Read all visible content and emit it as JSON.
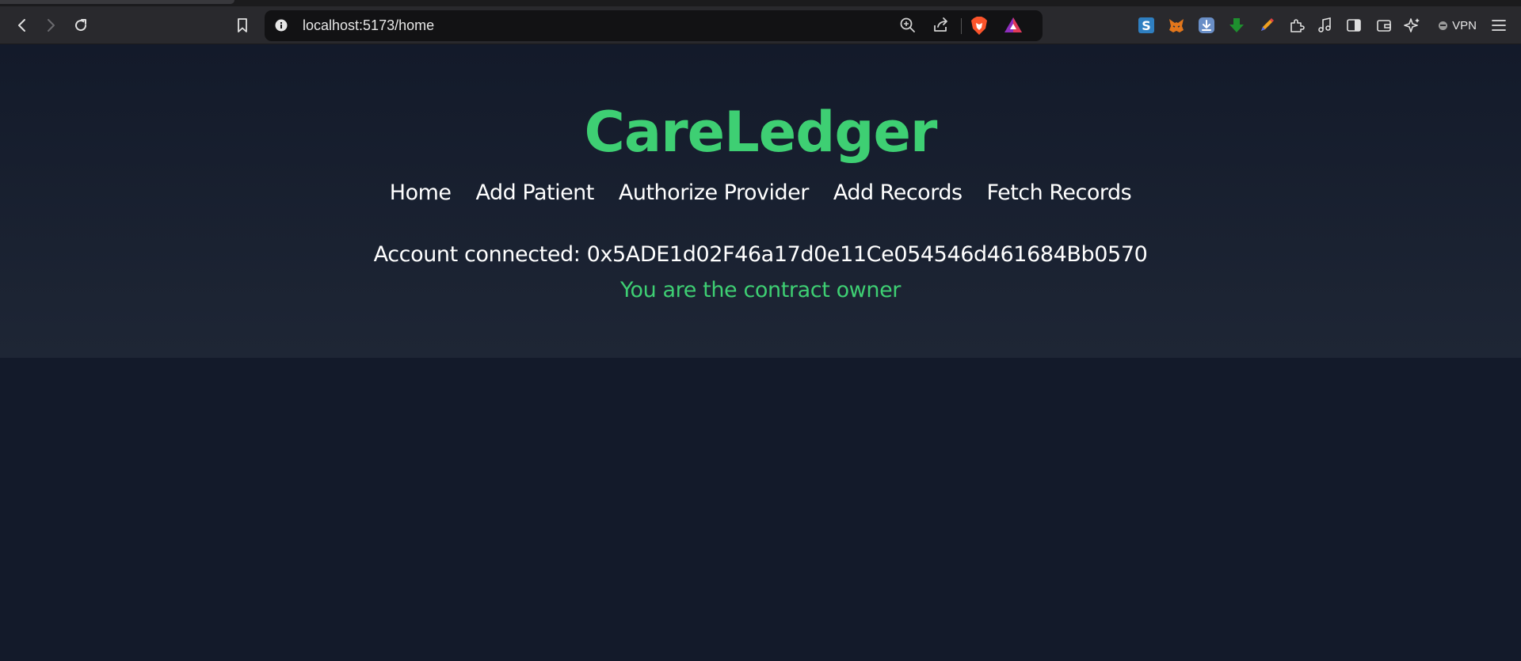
{
  "browser": {
    "url": "localhost:5173/home",
    "vpn_label": "VPN",
    "icons": [
      "back-icon",
      "forward-icon",
      "reload-icon",
      "bookmark-icon",
      "site-info-icon",
      "zoom-icon",
      "share-icon",
      "brave-shields-icon",
      "brave-rewards-icon",
      "extension-s-icon",
      "metamask-icon",
      "download-ext-icon",
      "green-arrow-ext-icon",
      "pencil-ext-icon",
      "extensions-icon",
      "media-icon",
      "sidebar-icon",
      "wallet-icon",
      "leo-ai-icon",
      "menu-icon"
    ]
  },
  "app": {
    "title": "CareLedger",
    "nav": [
      {
        "label": "Home"
      },
      {
        "label": "Add Patient"
      },
      {
        "label": "Authorize Provider"
      },
      {
        "label": "Add Records"
      },
      {
        "label": "Fetch Records"
      }
    ],
    "account_label": "Account connected: 0x5ADE1d02F46a17d0e11Ce054546d461684Bb0570",
    "owner_message": "You are the contract owner"
  },
  "colors": {
    "page_background": "#131a2a",
    "hero_bottom": "#1e2635",
    "accent_green": "#3ecf73",
    "nav_text": "#ffffff"
  }
}
